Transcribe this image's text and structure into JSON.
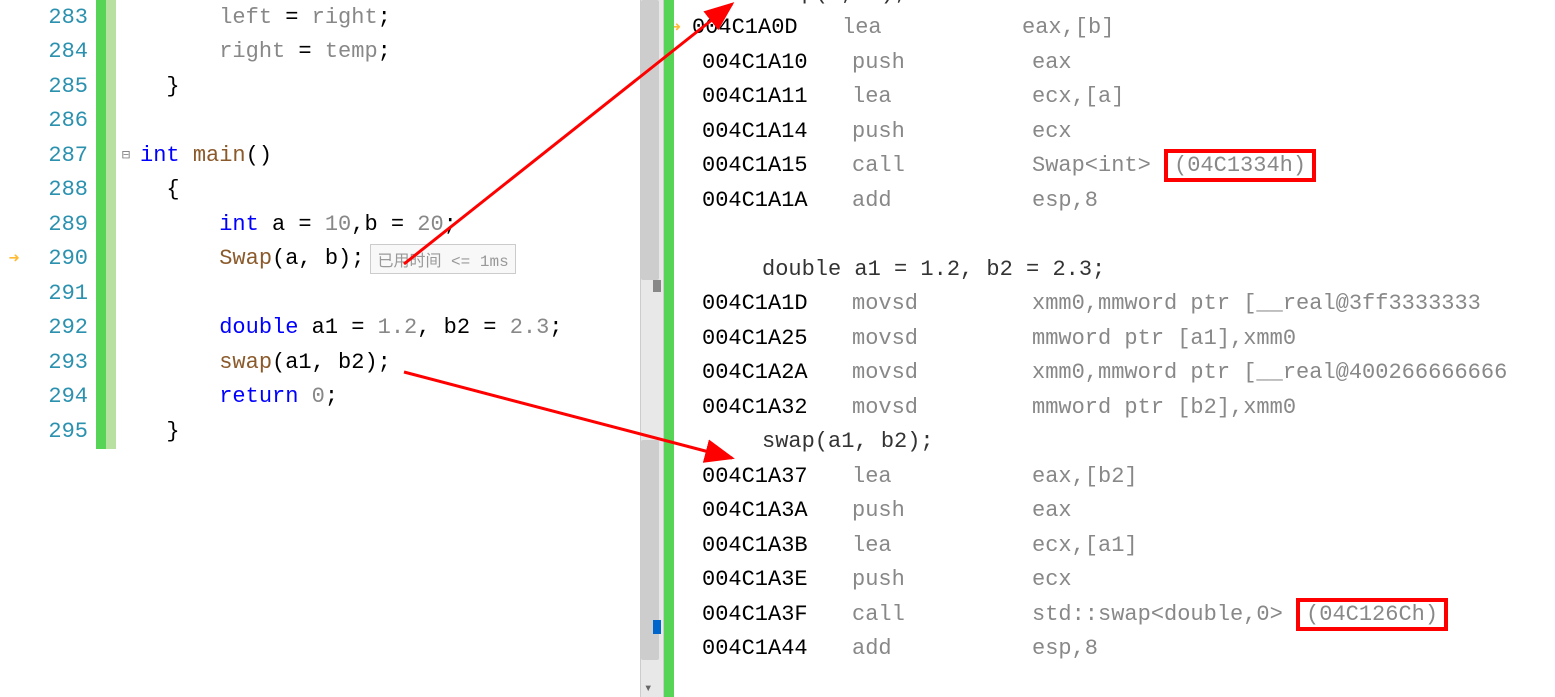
{
  "source": {
    "lines": [
      {
        "num": "283",
        "indent": "            ",
        "tokens": [
          {
            "t": "left",
            "c": "ident"
          },
          {
            "t": " = "
          },
          {
            "t": "right",
            "c": "ident"
          },
          {
            "t": ";"
          }
        ]
      },
      {
        "num": "284",
        "indent": "            ",
        "tokens": [
          {
            "t": "right",
            "c": "ident"
          },
          {
            "t": " = "
          },
          {
            "t": "temp",
            "c": "ident"
          },
          {
            "t": ";"
          }
        ]
      },
      {
        "num": "285",
        "indent": "        ",
        "tokens": [
          {
            "t": "}"
          }
        ]
      },
      {
        "num": "286",
        "indent": "",
        "tokens": []
      },
      {
        "num": "287",
        "indent": "      ",
        "fold": "⊟",
        "tokens": [
          {
            "t": "int",
            "c": "kw"
          },
          {
            "t": " "
          },
          {
            "t": "main",
            "c": "func"
          },
          {
            "t": "()"
          }
        ]
      },
      {
        "num": "288",
        "indent": "        ",
        "tokens": [
          {
            "t": "{"
          }
        ]
      },
      {
        "num": "289",
        "indent": "            ",
        "tokens": [
          {
            "t": "int",
            "c": "kw"
          },
          {
            "t": " a = "
          },
          {
            "t": "10",
            "c": "ident"
          },
          {
            "t": ",b = "
          },
          {
            "t": "20",
            "c": "ident"
          },
          {
            "t": ";"
          }
        ]
      },
      {
        "num": "290",
        "indent": "            ",
        "arrow": true,
        "tokens": [
          {
            "t": "Swap",
            "c": "func"
          },
          {
            "t": "(a, b);"
          }
        ],
        "tooltip": "已用时间 <= 1ms"
      },
      {
        "num": "291",
        "indent": "",
        "tokens": []
      },
      {
        "num": "292",
        "indent": "            ",
        "tokens": [
          {
            "t": "double",
            "c": "kw"
          },
          {
            "t": " a1 = "
          },
          {
            "t": "1.2",
            "c": "ident"
          },
          {
            "t": ", b2 = "
          },
          {
            "t": "2.3",
            "c": "ident"
          },
          {
            "t": ";"
          }
        ]
      },
      {
        "num": "293",
        "indent": "            ",
        "tokens": [
          {
            "t": "swap",
            "c": "func"
          },
          {
            "t": "(a1, b2);"
          }
        ]
      },
      {
        "num": "294",
        "indent": "            ",
        "tokens": [
          {
            "t": "return",
            "c": "kw"
          },
          {
            "t": " "
          },
          {
            "t": "0",
            "c": "ident"
          },
          {
            "t": ";"
          }
        ]
      },
      {
        "num": "295",
        "indent": "        ",
        "tokens": [
          {
            "t": "}"
          }
        ]
      }
    ]
  },
  "asm": {
    "lines": [
      {
        "type": "src",
        "text": "Swap(a, b);"
      },
      {
        "type": "asm",
        "arrow": true,
        "addr": "004C1A0D",
        "mnem": "lea",
        "ops": "eax,[b]"
      },
      {
        "type": "asm",
        "addr": "004C1A10",
        "mnem": "push",
        "ops": "eax"
      },
      {
        "type": "asm",
        "addr": "004C1A11",
        "mnem": "lea",
        "ops": "ecx,[a]"
      },
      {
        "type": "asm",
        "addr": "004C1A14",
        "mnem": "push",
        "ops": "ecx"
      },
      {
        "type": "asm",
        "addr": "004C1A15",
        "mnem": "call",
        "ops": "Swap<int> ",
        "box": "(04C1334h)"
      },
      {
        "type": "asm",
        "addr": "004C1A1A",
        "mnem": "add",
        "ops": "esp,8"
      },
      {
        "type": "blank"
      },
      {
        "type": "src",
        "text": "double a1 = 1.2, b2 = 2.3;"
      },
      {
        "type": "asm",
        "addr": "004C1A1D",
        "mnem": "movsd",
        "ops": "xmm0,mmword ptr [__real@3ff3333333"
      },
      {
        "type": "asm",
        "addr": "004C1A25",
        "mnem": "movsd",
        "ops": "mmword ptr [a1],xmm0"
      },
      {
        "type": "asm",
        "addr": "004C1A2A",
        "mnem": "movsd",
        "ops": "xmm0,mmword ptr [__real@400266666666"
      },
      {
        "type": "asm",
        "addr": "004C1A32",
        "mnem": "movsd",
        "ops": "mmword ptr [b2],xmm0"
      },
      {
        "type": "src",
        "text": "swap(a1, b2);"
      },
      {
        "type": "asm",
        "addr": "004C1A37",
        "mnem": "lea",
        "ops": "eax,[b2]"
      },
      {
        "type": "asm",
        "addr": "004C1A3A",
        "mnem": "push",
        "ops": "eax"
      },
      {
        "type": "asm",
        "addr": "004C1A3B",
        "mnem": "lea",
        "ops": "ecx,[a1]"
      },
      {
        "type": "asm",
        "addr": "004C1A3E",
        "mnem": "push",
        "ops": "ecx"
      },
      {
        "type": "asm",
        "addr": "004C1A3F",
        "mnem": "call",
        "ops": "std::swap<double,0> ",
        "box": "(04C126Ch)"
      },
      {
        "type": "asm",
        "addr": "004C1A44",
        "mnem": "add",
        "ops": "esp,8"
      }
    ]
  },
  "highlights": {
    "box1": "(04C1334h)",
    "box2": "(04C126Ch)"
  }
}
